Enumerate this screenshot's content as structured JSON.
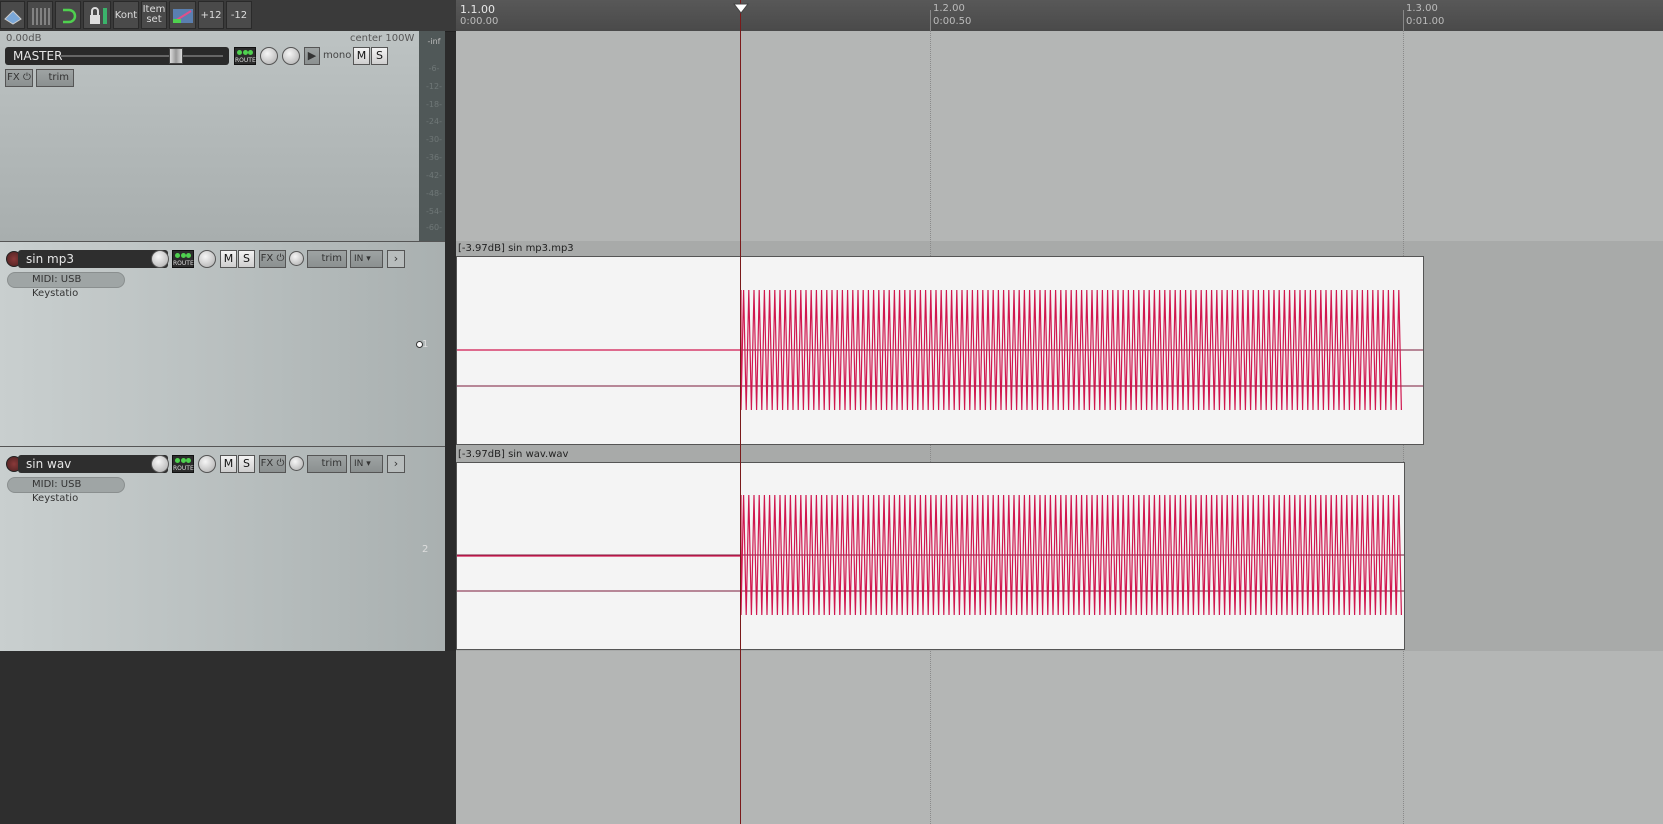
{
  "toolbar": {
    "buttons": [
      {
        "name": "snap-icon"
      },
      {
        "name": "grid-icon"
      },
      {
        "name": "ripple-icon"
      },
      {
        "name": "lock-icon"
      },
      {
        "label": "Kont"
      },
      {
        "label1": "Item",
        "label2": "set"
      },
      {
        "name": "crossfade-icon"
      },
      {
        "label": "+12"
      },
      {
        "label": "-12"
      }
    ]
  },
  "master": {
    "volume": "0.00dB",
    "pan": "center",
    "width": "100W",
    "name": "MASTER",
    "route": "ROUTE",
    "mono": "mono",
    "mute": "M",
    "solo": "S",
    "fx": "FX",
    "trim": "trim"
  },
  "meter_scale": [
    "-inf",
    "-6-",
    "-12-",
    "-18-",
    "-24-",
    "-30-",
    "-36-",
    "-42-",
    "-48-",
    "-54-",
    "-60-"
  ],
  "tracks": [
    {
      "name": "sin mp3",
      "number": "1",
      "route": "ROUTE",
      "mute": "M",
      "solo": "S",
      "fx": "FX",
      "trim": "trim",
      "input": "IN",
      "midi": "MIDI: USB Keystatio",
      "item_label": "[-3.97dB] sin mp3.mp3"
    },
    {
      "name": "sin wav",
      "number": "2",
      "route": "ROUTE",
      "mute": "M",
      "solo": "S",
      "fx": "FX",
      "trim": "trim",
      "input": "IN",
      "midi": "MIDI: USB Keystatio",
      "item_label": "[-3.97dB] sin wav.wav"
    }
  ],
  "ruler": {
    "marks": [
      {
        "bar": "1.1.00",
        "time": "0:00.00"
      },
      {
        "bar": "1.2.00",
        "time": "0:00.50"
      },
      {
        "bar": "1.3.00",
        "time": "0:01.00"
      }
    ]
  },
  "colors": {
    "waveform": "#d0174f",
    "cursor": "#7a1a1a",
    "item_bg": "#f4f4f4"
  }
}
